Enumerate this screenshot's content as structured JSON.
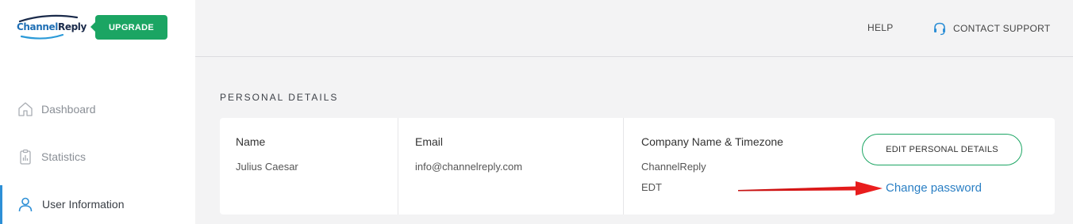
{
  "logo": {
    "part1": "Channel",
    "part2": "Reply"
  },
  "sidebar": {
    "upgrade_label": "UPGRADE",
    "items": [
      {
        "label": "Dashboard",
        "icon": "home-icon",
        "active": false
      },
      {
        "label": "Statistics",
        "icon": "clipboard-chart-icon",
        "active": false
      },
      {
        "label": "User Information",
        "icon": "user-icon",
        "active": true
      }
    ]
  },
  "header": {
    "help_label": "HELP",
    "support_label": "CONTACT SUPPORT",
    "support_icon": "headset-icon"
  },
  "main": {
    "section_title": "PERSONAL DETAILS",
    "name": {
      "heading": "Name",
      "value": "Julius Caesar"
    },
    "email": {
      "heading": "Email",
      "value": "info@channelreply.com"
    },
    "company": {
      "heading": "Company Name & Timezone",
      "name": "ChannelReply",
      "timezone": "EDT"
    },
    "edit_button_label": "EDIT PERSONAL DETAILS",
    "change_password_label": "Change password"
  },
  "colors": {
    "accent_green": "#1ba563",
    "accent_blue": "#2d8fd6",
    "link_blue": "#2a7fc4",
    "arrow_red": "#e01b1b"
  }
}
